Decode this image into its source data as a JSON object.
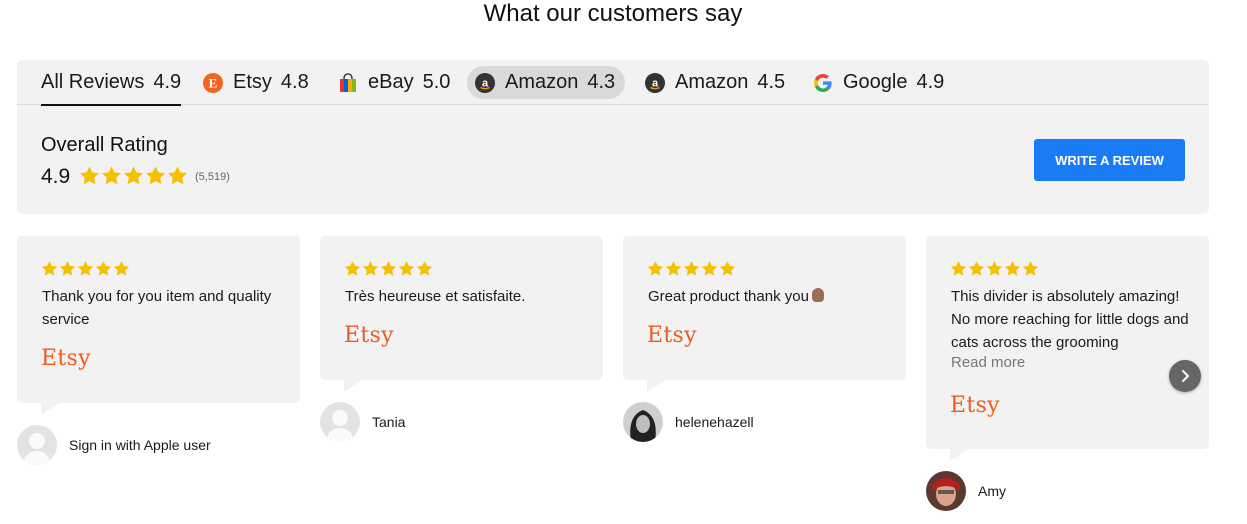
{
  "header": {
    "title": "What our customers say"
  },
  "tabs": [
    {
      "label": "All Reviews",
      "score": "4.9",
      "icon": null
    },
    {
      "label": "Etsy",
      "score": "4.8",
      "icon": "etsy-icon"
    },
    {
      "label": "eBay",
      "score": "5.0",
      "icon": "ebay-bag-icon"
    },
    {
      "label": "Amazon",
      "score": "4.3",
      "icon": "amazon-icon"
    },
    {
      "label": "Amazon",
      "score": "4.5",
      "icon": "amazon-icon"
    },
    {
      "label": "Google",
      "score": "4.9",
      "icon": "google-icon"
    }
  ],
  "overall": {
    "label": "Overall Rating",
    "score": "4.9",
    "stars": 5,
    "count": "(5,519)",
    "write_button": "WRITE A REVIEW"
  },
  "reviews": [
    {
      "stars": 5,
      "text": "Thank you for you item and quality service",
      "source": "Etsy",
      "reviewer": "Sign in with Apple user",
      "avatar": "default-avatar-icon"
    },
    {
      "stars": 5,
      "text": "Très heureuse et satisfaite.",
      "source": "Etsy",
      "reviewer": "Tania",
      "avatar": "default-avatar-icon"
    },
    {
      "stars": 5,
      "text": "Great product thank you",
      "emoji": "thumbs-up-emoji",
      "source": "Etsy",
      "reviewer": "helenehazell",
      "avatar": "user-photo-avatar"
    },
    {
      "stars": 5,
      "text": "This divider is absolutely amazing! No more reaching for little dogs and cats across the grooming",
      "read_more": "Read more",
      "source": "Etsy",
      "reviewer": "Amy",
      "avatar": "user-photo-avatar"
    }
  ],
  "colors": {
    "star": "#f5c000",
    "accent_button": "#1a7cf5",
    "etsy": "#ef5b1a",
    "panel": "#f2f2f2"
  }
}
